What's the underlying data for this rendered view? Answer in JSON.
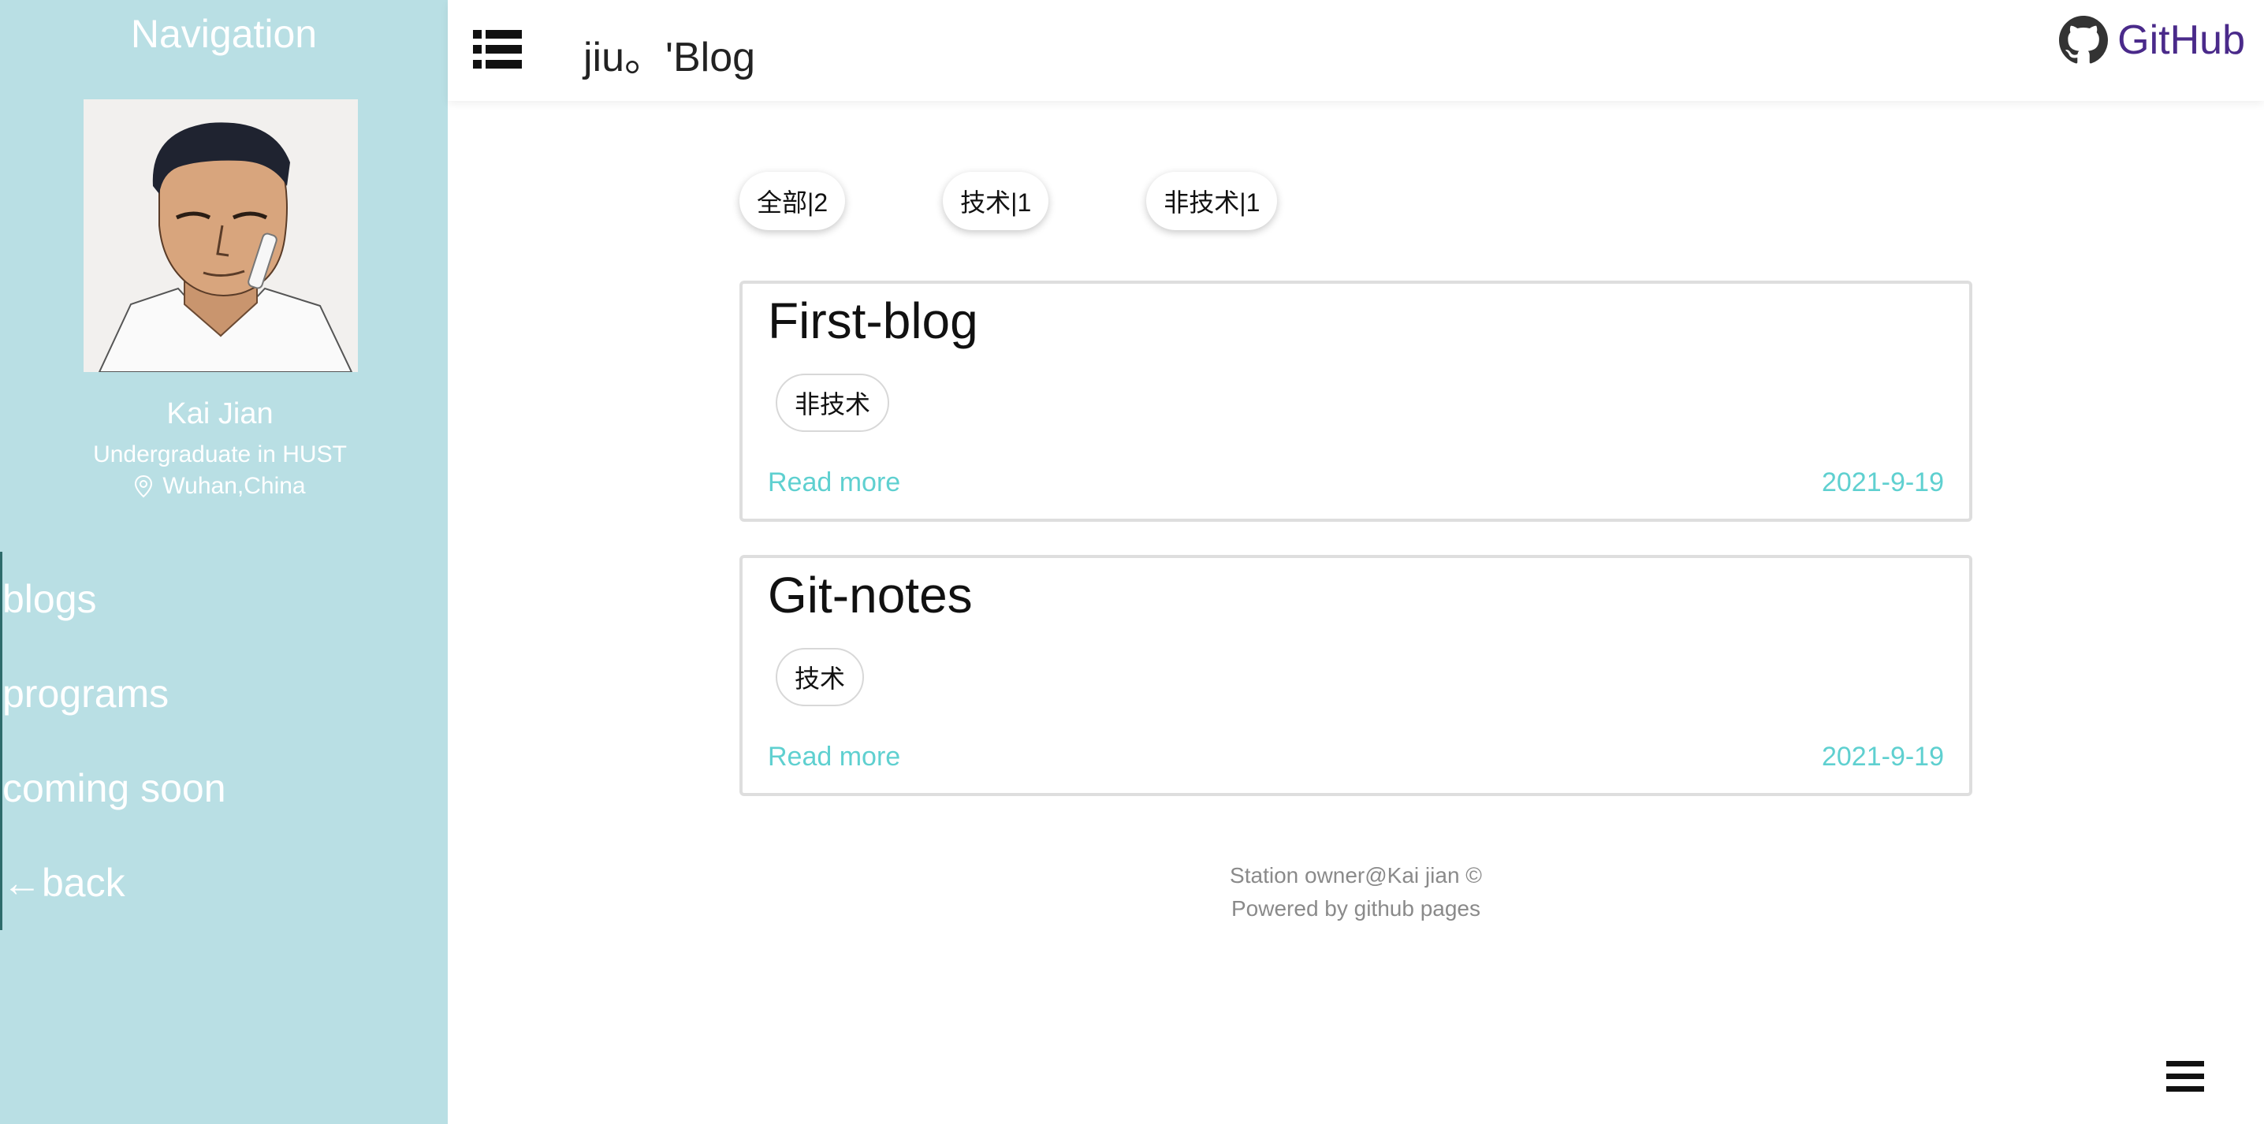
{
  "sidebar": {
    "title": "Navigation",
    "owner": {
      "name": "Kai Jian",
      "description": "Undergraduate in HUST",
      "location": "Wuhan,China"
    },
    "nav_items": [
      {
        "label": "blogs"
      },
      {
        "label": "programs"
      },
      {
        "label": "coming soon"
      },
      {
        "label": "←back"
      }
    ]
  },
  "header": {
    "site_title": "jiu。'Blog",
    "github_label": "GitHub"
  },
  "filters": [
    {
      "label": "全部|2"
    },
    {
      "label": "技术|1"
    },
    {
      "label": "非技术|1"
    }
  ],
  "posts": [
    {
      "title": "First-blog",
      "tag": "非技术",
      "read_more": "Read more",
      "date": "2021-9-19"
    },
    {
      "title": "Git-notes",
      "tag": "技术",
      "read_more": "Read more",
      "date": "2021-9-19"
    }
  ],
  "footer": {
    "line1": "Station owner@Kai jian ©",
    "line2": "Powered by github pages"
  },
  "colors": {
    "sidebar_bg": "#b9dfe4",
    "accent_link": "#5fd0d0",
    "github_purple": "#4a2a8a"
  },
  "icons": {
    "menu": "list-menu-icon",
    "github": "github-octocat-icon",
    "location": "location-pin-icon",
    "bottom_menu": "hamburger-icon"
  }
}
